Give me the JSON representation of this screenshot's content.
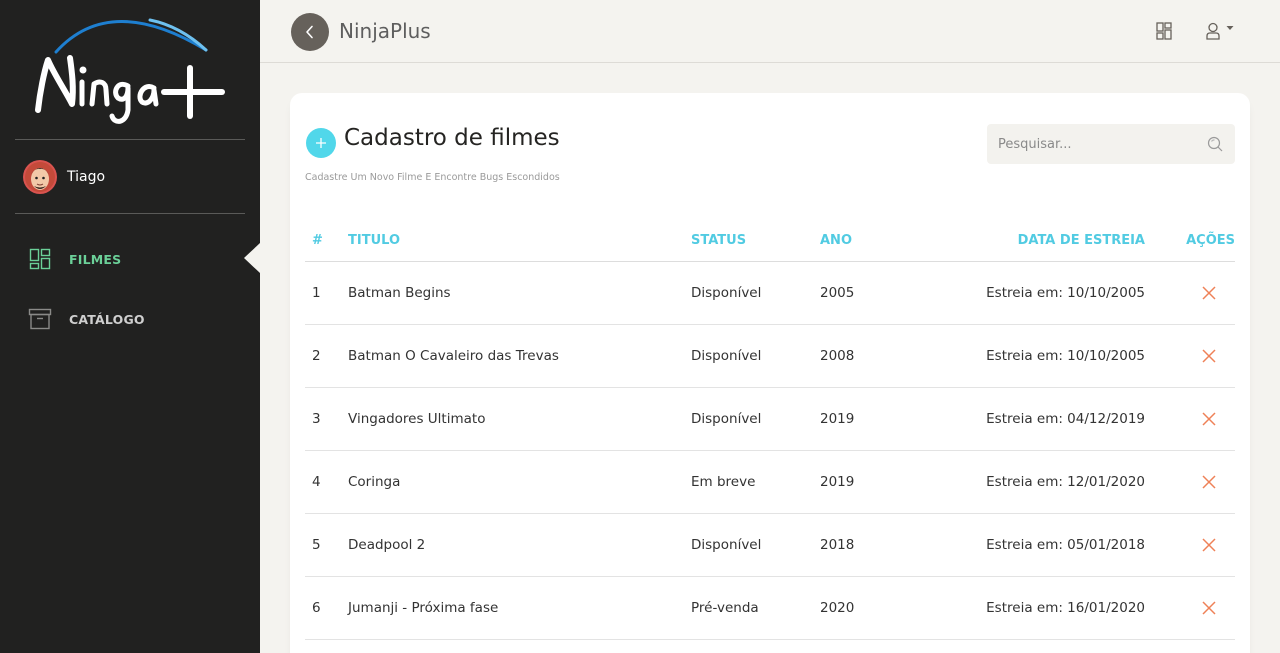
{
  "sidebar": {
    "logo_text": "Ninja+",
    "user_name": "Tiago",
    "items": [
      {
        "label": "FILMES",
        "icon": "dashboard-icon",
        "active": true
      },
      {
        "label": "CATÁLOGO",
        "icon": "archive-box-icon",
        "active": false
      }
    ]
  },
  "navbar": {
    "brand": "NinjaPlus"
  },
  "card": {
    "title": "Cadastro de filmes",
    "subtitle": "Cadastre Um Novo Filme E Encontre Bugs Escondidos",
    "search_placeholder": "Pesquisar..."
  },
  "table": {
    "headers": [
      "#",
      "TITULO",
      "STATUS",
      "ANO",
      "DATA DE ESTREIA",
      "AÇÕES"
    ],
    "rows": [
      {
        "num": "1",
        "title": "Batman Begins",
        "status": "Disponível",
        "year": "2005",
        "date": "Estreia em: 10/10/2005"
      },
      {
        "num": "2",
        "title": "Batman O Cavaleiro das Trevas",
        "status": "Disponível",
        "year": "2008",
        "date": "Estreia em: 10/10/2005"
      },
      {
        "num": "3",
        "title": "Vingadores Ultimato",
        "status": "Disponível",
        "year": "2019",
        "date": "Estreia em: 04/12/2019"
      },
      {
        "num": "4",
        "title": "Coringa",
        "status": "Em breve",
        "year": "2019",
        "date": "Estreia em: 12/01/2020"
      },
      {
        "num": "5",
        "title": "Deadpool 2",
        "status": "Disponível",
        "year": "2018",
        "date": "Estreia em: 05/01/2018"
      },
      {
        "num": "6",
        "title": "Jumanji - Próxima fase",
        "status": "Pré-venda",
        "year": "2020",
        "date": "Estreia em: 16/01/2020"
      }
    ]
  },
  "colors": {
    "sidebar_bg": "#212120",
    "accent_cyan": "#51cbe2",
    "active_green": "#6bd098",
    "delete_red": "#ef8157"
  }
}
